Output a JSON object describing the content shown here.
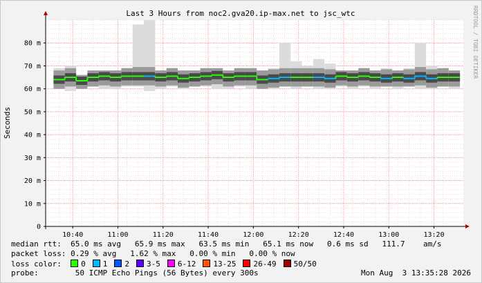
{
  "chart_data": {
    "type": "line",
    "title": "Last 3 Hours from noc2.gva20.ip-max.net to jsc_wtc",
    "ylabel": "Seconds",
    "watermark": "RRDTOOL / TOBI OETIKER",
    "ylim": [
      0,
      90
    ],
    "y_ticks": [
      0,
      10,
      20,
      30,
      40,
      50,
      60,
      70,
      80
    ],
    "y_tick_labels": [
      "0",
      "10 m",
      "20 m",
      "30 m",
      "40 m",
      "50 m",
      "60 m",
      "70 m",
      "80 m"
    ],
    "x_tick_labels": [
      "10:40",
      "11:00",
      "11:20",
      "11:40",
      "12:00",
      "12:20",
      "12:40",
      "13:00",
      "13:20"
    ],
    "x_unit_minutes": [
      0,
      5,
      10,
      15,
      20,
      25,
      30,
      35,
      40,
      45,
      50,
      55,
      60,
      65,
      70,
      75,
      80,
      85,
      90,
      95,
      100,
      105,
      110,
      115,
      120,
      125,
      130,
      135,
      140,
      145,
      150,
      155,
      160,
      165,
      170,
      175
    ],
    "series": [
      {
        "values": [
          64,
          65,
          63.5,
          65,
          65.5,
          65,
          65.5,
          65.5,
          65.5,
          65,
          65.5,
          64.5,
          65,
          65.5,
          66,
          65,
          65.5,
          65.5,
          64,
          64.5,
          65,
          65,
          65,
          65,
          64.5,
          65.5,
          65,
          65.5,
          65,
          64.5,
          65,
          64.5,
          65.5,
          64.5,
          65,
          65
        ],
        "colors": [
          "0",
          "0",
          "0",
          "0",
          "0",
          "0",
          "0",
          "0",
          "1",
          "0",
          "0",
          "0",
          "0",
          "0",
          "0",
          "0",
          "0",
          "0",
          "0",
          "1",
          "1",
          "0",
          "0",
          "1",
          "1",
          "0",
          "0",
          "0",
          "0",
          "1",
          "0",
          "1",
          "1",
          "1",
          "0",
          "0"
        ]
      }
    ],
    "smoke_max": [
      69,
      70,
      66,
      68,
      68,
      68,
      69,
      88,
      90,
      68,
      69,
      68,
      68,
      69,
      69,
      68,
      69,
      69,
      68,
      69,
      80,
      72,
      70,
      73,
      71,
      68,
      68,
      69,
      68,
      69,
      68,
      69,
      80,
      70,
      69,
      68
    ],
    "smoke_min": [
      60,
      59,
      60,
      61,
      60,
      60,
      61,
      61,
      59,
      60,
      61,
      60,
      61,
      61,
      60,
      60,
      61,
      60,
      60,
      60,
      61,
      60,
      61,
      60,
      60,
      61,
      60,
      61,
      60,
      61,
      60,
      61,
      60,
      60,
      61,
      60
    ],
    "grid": true,
    "colors": {
      "background": "#ffffff",
      "canvas": "#f2f2f2",
      "major_grid": "#f0a0a0",
      "minor_grid": "#f6d8d8",
      "axis": "#000000",
      "smoke_outer": "#dcdcdc",
      "smoke_mid": "#9a9a9a",
      "smoke_core": "#4a4a4a",
      "loss_0": "#26ff00",
      "loss_1": "#00b8ff",
      "loss_2": "#0059ff",
      "loss_3-5": "#5e00ff",
      "loss_6-12": "#ff00ff",
      "loss_13-25": "#ff5500",
      "loss_26-49": "#ff0000",
      "loss_50/50": "#a10000"
    }
  },
  "stats": {
    "median_label": "median rtt:",
    "median_values": "65.0 ms avg   65.9 ms max   63.5 ms min   65.1 ms now   0.6 ms sd   111.7    am/s",
    "loss_label": "packet loss:",
    "loss_values": "0.29 % avg   1.62 % max   0.00 % min   0.00 % now",
    "loss_color_label": "loss color:",
    "loss_colors": [
      {
        "key": "loss_0",
        "label": "0"
      },
      {
        "key": "loss_1",
        "label": "1"
      },
      {
        "key": "loss_2",
        "label": "2"
      },
      {
        "key": "loss_3-5",
        "label": "3-5"
      },
      {
        "key": "loss_6-12",
        "label": "6-12"
      },
      {
        "key": "loss_13-25",
        "label": "13-25"
      },
      {
        "key": "loss_26-49",
        "label": "26-49"
      },
      {
        "key": "loss_50/50",
        "label": "50/50"
      }
    ],
    "probe_label": "probe:",
    "probe_value": "50 ICMP Echo Pings (56 Bytes) every 300s",
    "timestamp": "Mon Aug  3 13:35:28 2026"
  }
}
